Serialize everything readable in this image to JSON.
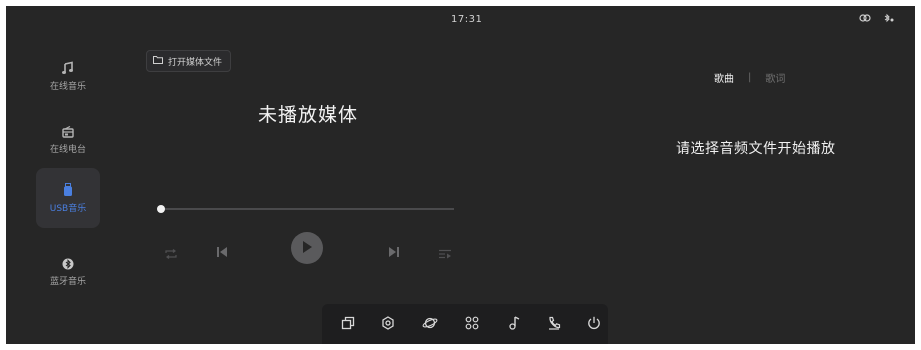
{
  "status_bar": {
    "time": "17:31",
    "icons": [
      "link-icon",
      "bluetooth-off-icon"
    ]
  },
  "sidebar": {
    "items": [
      {
        "label": "在线音乐",
        "icon": "music-note-icon",
        "active": false
      },
      {
        "label": "在线电台",
        "icon": "radio-icon",
        "active": false
      },
      {
        "label": "USB音乐",
        "icon": "usb-drive-icon",
        "active": true
      },
      {
        "label": "蓝牙音乐",
        "icon": "bluetooth-icon",
        "active": false
      }
    ]
  },
  "player": {
    "open_file_label": "打开媒体文件",
    "title": "未播放媒体",
    "progress": 0,
    "controls": [
      "repeat-icon",
      "previous-icon",
      "play-icon",
      "next-icon",
      "playlist-icon"
    ]
  },
  "lyrics_panel": {
    "tab_songs": "歌曲",
    "tab_separator": "|",
    "tab_lyrics": "歌词",
    "empty_hint": "请选择音频文件开始播放"
  },
  "dock": {
    "items": [
      "window-icon",
      "settings-icon",
      "planet-icon",
      "apps-grid-icon",
      "music-icon",
      "phone-icon",
      "power-timer-icon"
    ]
  },
  "colors": {
    "background": "#262626",
    "accent": "#4a7fe0",
    "text": "#f0f0f0"
  }
}
